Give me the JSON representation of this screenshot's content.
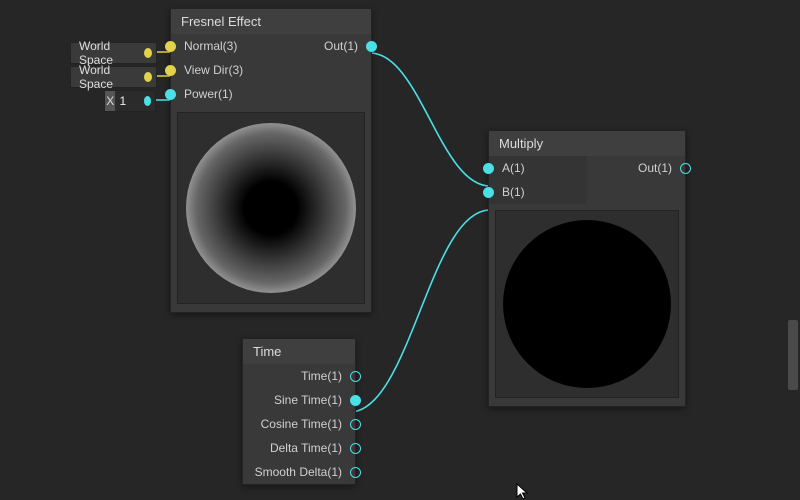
{
  "nodes": {
    "fresnel": {
      "title": "Fresnel Effect",
      "inputs": [
        "Normal(3)",
        "View Dir(3)",
        "Power(1)"
      ],
      "output": "Out(1)",
      "ext": {
        "spaceA": "World Space",
        "spaceB": "World Space",
        "x_label": "X",
        "x_value": "1"
      }
    },
    "time": {
      "title": "Time",
      "outputs": [
        "Time(1)",
        "Sine Time(1)",
        "Cosine Time(1)",
        "Delta Time(1)",
        "Smooth Delta(1)"
      ]
    },
    "multiply": {
      "title": "Multiply",
      "inputs": [
        "A(1)",
        "B(1)"
      ],
      "output": "Out(1)"
    }
  },
  "colors": {
    "wire": "#49e0e6"
  }
}
